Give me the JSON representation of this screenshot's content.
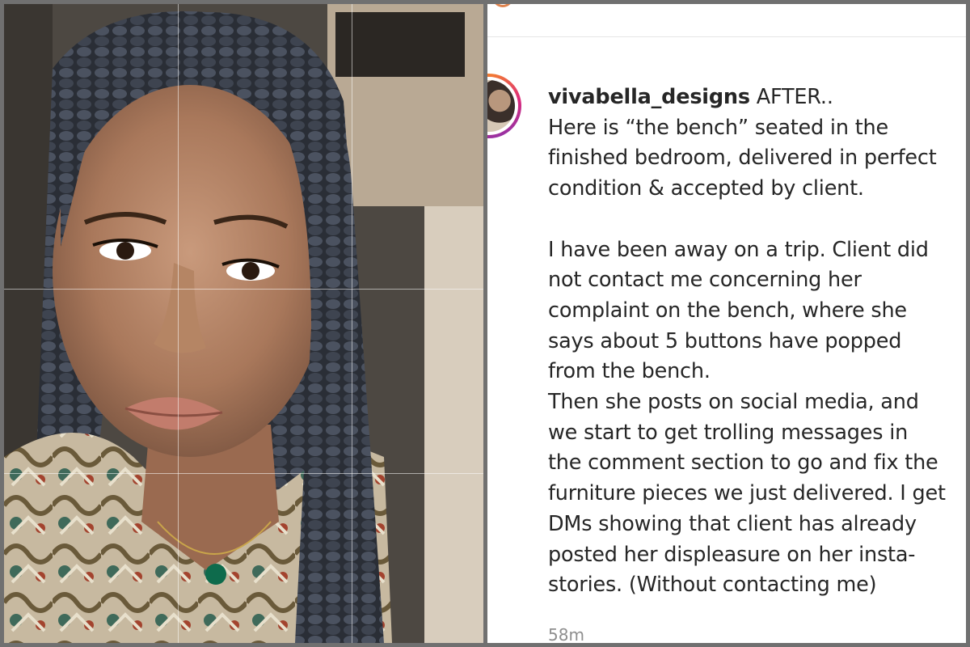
{
  "post": {
    "username": "vivabella_designs",
    "caption_first": "AFTER..",
    "caption_lines_1": [
      "Here is “the bench” seated in the",
      "finished bedroom, delivered in perfect",
      "condition & accepted by client."
    ],
    "caption_lines_2": [
      "I have been away on a trip. Client did",
      "not contact me concerning her",
      "complaint on the bench, where she",
      "says about 5 buttons have popped",
      "from the bench.",
      "Then she posts on social media, and",
      "we start to get trolling messages in",
      "the comment section to go and fix the",
      "furniture pieces we just delivered. I get",
      "DMs showing that client has already",
      "posted her displeasure on her insta-",
      "stories. (Without contacting me)"
    ],
    "timestamp": "58m"
  },
  "colors": {
    "text": "#262626",
    "muted": "#8e8e8e",
    "ring_start": "#f58529",
    "ring_end": "#8134af"
  }
}
